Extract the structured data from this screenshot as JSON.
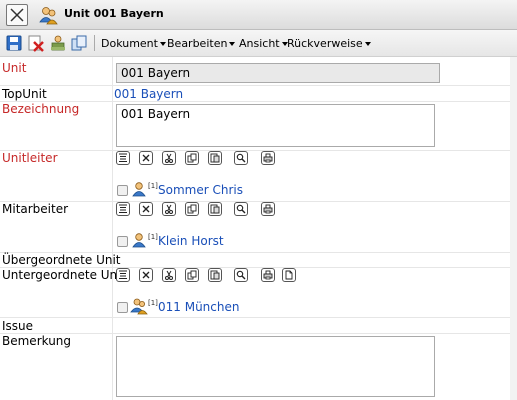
{
  "window": {
    "title": "Unit 001 Bayern"
  },
  "toolbar": {
    "icons": [
      "save-icon",
      "delete-icon",
      "add-user-icon",
      "copy-icon"
    ],
    "menus": [
      {
        "label": "Dokument"
      },
      {
        "label": "Bearbeiten"
      },
      {
        "label": "Ansicht"
      },
      {
        "label": "Rückverweise"
      }
    ]
  },
  "form": {
    "unit": {
      "label": "Unit",
      "value": "001 Bayern"
    },
    "topunit": {
      "label": "TopUnit",
      "value": "001 Bayern"
    },
    "bezeichnung": {
      "label": "Bezeichnung",
      "value": "001 Bayern"
    },
    "unitleiter": {
      "label": "Unitleiter",
      "entries": [
        {
          "badge": "[1]",
          "name": "Sommer Chris"
        }
      ]
    },
    "mitarbeiter": {
      "label": "Mitarbeiter",
      "entries": [
        {
          "badge": "[1]",
          "name": "Klein Horst"
        }
      ]
    },
    "uebergeordnete": {
      "label": "Übergeordnete Unit"
    },
    "untergeordnete": {
      "label": "Untergeordnete Unit",
      "entries": [
        {
          "badge": "[1]",
          "name": "011 München"
        }
      ]
    },
    "issue": {
      "label": "Issue"
    },
    "bemerkung": {
      "label": "Bemerkung",
      "value": ""
    }
  },
  "row_actions": [
    "align-icon",
    "remove-icon",
    "cut-icon",
    "copy-icon",
    "paste-icon",
    "search-icon",
    "print-icon",
    "new-document-icon"
  ],
  "colors": {
    "label_required": "#c62828",
    "link": "#1a4fb8",
    "readonly_bg": "#e9e9e9"
  }
}
